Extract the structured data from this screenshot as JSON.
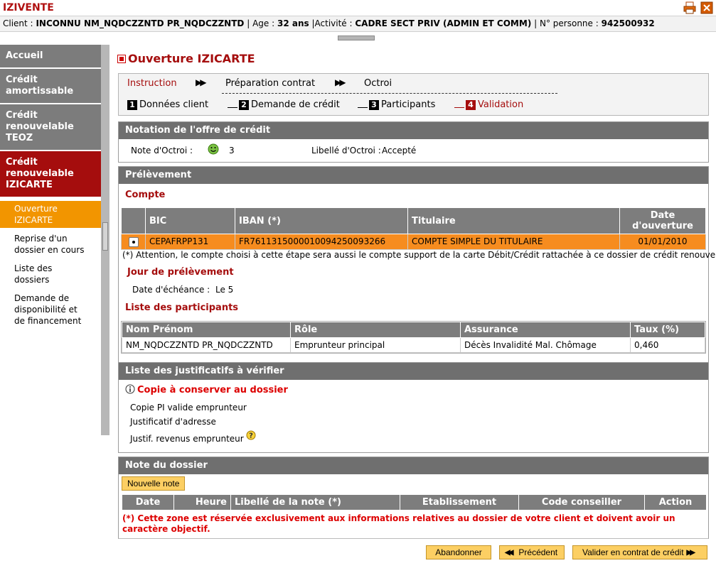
{
  "app": {
    "title": "IZIVENTE"
  },
  "client_bar": {
    "client_label": "Client :",
    "client_value": "INCONNU NM_NQDCZZNTD PR_NQDCZZNTD",
    "age_label": "Age :",
    "age_value": "32 ans",
    "activite_label": "Activité :",
    "activite_value": "CADRE SECT PRIV (ADMIN ET COMM)",
    "personne_label": "N° personne :",
    "personne_value": "942500932"
  },
  "sidebar": {
    "items": [
      {
        "label": "Accueil"
      },
      {
        "label": "Crédit amortissable"
      },
      {
        "label": "Crédit renouvelable TEOZ"
      },
      {
        "label": "Crédit renouvelable IZICARTE"
      }
    ],
    "subitems": [
      {
        "label": "Ouverture IZICARTE"
      },
      {
        "label": "Reprise d'un dossier en cours"
      },
      {
        "label": "Liste des dossiers"
      },
      {
        "label": "Demande de disponibilité et de financement"
      }
    ]
  },
  "page": {
    "title": "Ouverture IZICARTE"
  },
  "steps": {
    "top": [
      "Instruction",
      "Préparation contrat",
      "Octroi"
    ],
    "sub": [
      {
        "num": "1",
        "label": "Données client"
      },
      {
        "num": "2",
        "label": "Demande de crédit"
      },
      {
        "num": "3",
        "label": "Participants"
      },
      {
        "num": "4",
        "label": "Validation"
      }
    ]
  },
  "notation": {
    "header": "Notation de l'offre de crédit",
    "note_label": "Note d'Octroi :",
    "note_value": "3",
    "libelle_label": "Libellé d'Octroi :",
    "libelle_value": "Accepté"
  },
  "prelevement": {
    "header": "Prélèvement",
    "compte_title": "Compte",
    "columns": [
      "BIC",
      "IBAN (*)",
      "Titulaire",
      "Date d'ouverture"
    ],
    "row": {
      "bic": "CEPAFRPP131",
      "iban": "FR7611315000010094250093266",
      "titulaire": "COMPTE SIMPLE DU TITULAIRE",
      "date": "01/01/2010"
    },
    "note": "(*) Attention, le compte choisi à cette étape sera aussi le compte support de la carte Débit/Crédit rattachée à ce dossier de crédit renouvelable",
    "jour_title": "Jour de prélèvement",
    "echeance_label": "Date d'échéance :",
    "echeance_value": "Le 5",
    "participants_title": "Liste des participants",
    "participants_columns": [
      "Nom Prénom",
      "Rôle",
      "Assurance",
      "Taux (%)"
    ],
    "participants": [
      {
        "nom": "NM_NQDCZZNTD PR_NQDCZZNTD",
        "role": "Emprunteur principal",
        "assurance": "Décès Invalidité Mal. Chômage",
        "taux": "0,460"
      }
    ]
  },
  "justificatifs": {
    "header": "Liste des justificatifs à vérifier",
    "copie_title": "Copie à conserver au dossier",
    "items": [
      "Copie PI valide emprunteur",
      "Justificatif d'adresse",
      "Justif. revenus emprunteur"
    ]
  },
  "note_dossier": {
    "header": "Note du dossier",
    "new_button": "Nouvelle note",
    "columns": [
      "Date",
      "Heure",
      "Libellé de la note (*)",
      "Etablissement",
      "Code conseiller",
      "Action"
    ],
    "warning": "(*) Cette zone est réservée exclusivement aux informations relatives au dossier de votre client et doivent avoir un caractère objectif."
  },
  "footer": {
    "abandon": "Abandonner",
    "precedent": "Précédent",
    "valider": "Valider en contrat de crédit"
  },
  "colors": {
    "brand_red": "#a50d0d",
    "orange": "#f68c1f",
    "button_yellow": "#fccf63",
    "header_gray": "#6f6f6f"
  }
}
